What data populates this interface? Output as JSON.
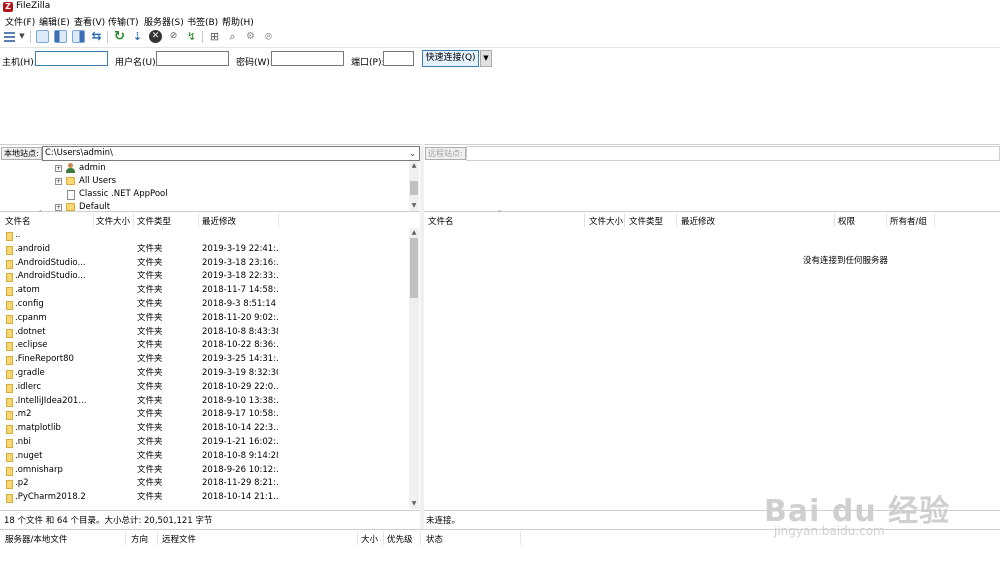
{
  "window": {
    "title": "FileZilla"
  },
  "menu": [
    "文件(F)",
    "编辑(E)",
    "查看(V)",
    "传输(T)",
    "服务器(S)",
    "书签(B)",
    "帮助(H)"
  ],
  "quickconnect": {
    "host_label": "主机(H):",
    "user_label": "用户名(U):",
    "pass_label": "密码(W):",
    "port_label": "端口(P):",
    "connect_label": "快速连接(Q)",
    "host_value": "",
    "user_value": "",
    "pass_value": "",
    "port_value": ""
  },
  "local": {
    "site_label": "本地站点:",
    "path": "C:\\Users\\admin\\",
    "tree": [
      {
        "label": "admin",
        "icon": "user-folder"
      },
      {
        "label": "All Users",
        "icon": "folder"
      },
      {
        "label": "Classic .NET AppPool",
        "icon": "document"
      },
      {
        "label": "Default",
        "icon": "folder"
      }
    ],
    "columns": [
      "文件名",
      "文件大小",
      "文件类型",
      "最近修改"
    ],
    "files": [
      {
        "name": "..",
        "type": "",
        "modified": ""
      },
      {
        "name": ".android",
        "type": "文件夹",
        "modified": "2019-3-19 22:41:..."
      },
      {
        "name": ".AndroidStudio...",
        "type": "文件夹",
        "modified": "2019-3-18 23:16:..."
      },
      {
        "name": ".AndroidStudio...",
        "type": "文件夹",
        "modified": "2019-3-18 22:33:..."
      },
      {
        "name": ".atom",
        "type": "文件夹",
        "modified": "2018-11-7 14:58:..."
      },
      {
        "name": ".config",
        "type": "文件夹",
        "modified": "2018-9-3 8:51:14"
      },
      {
        "name": ".cpanm",
        "type": "文件夹",
        "modified": "2018-11-20 9:02:..."
      },
      {
        "name": ".dotnet",
        "type": "文件夹",
        "modified": "2018-10-8 8:43:38"
      },
      {
        "name": ".eclipse",
        "type": "文件夹",
        "modified": "2018-10-22 8:36:..."
      },
      {
        "name": ".FineReport80",
        "type": "文件夹",
        "modified": "2019-3-25 14:31:..."
      },
      {
        "name": ".gradle",
        "type": "文件夹",
        "modified": "2019-3-19 8:32:30"
      },
      {
        "name": ".idlerc",
        "type": "文件夹",
        "modified": "2018-10-29 22:0..."
      },
      {
        "name": ".IntelliJIdea201...",
        "type": "文件夹",
        "modified": "2018-9-10 13:38:..."
      },
      {
        "name": ".m2",
        "type": "文件夹",
        "modified": "2018-9-17 10:58:..."
      },
      {
        "name": ".matplotlib",
        "type": "文件夹",
        "modified": "2018-10-14 22:3..."
      },
      {
        "name": ".nbi",
        "type": "文件夹",
        "modified": "2019-1-21 16:02:..."
      },
      {
        "name": ".nuget",
        "type": "文件夹",
        "modified": "2018-10-8 9:14:28"
      },
      {
        "name": ".omnisharp",
        "type": "文件夹",
        "modified": "2018-9-26 10:12:..."
      },
      {
        "name": ".p2",
        "type": "文件夹",
        "modified": "2018-11-29 8:21:..."
      },
      {
        "name": ".PyCharm2018.2",
        "type": "文件夹",
        "modified": "2018-10-14 21:1..."
      }
    ],
    "status": "18 个文件 和 64 个目录。大小总计: 20,501,121 字节"
  },
  "remote": {
    "site_label": "远程站点:",
    "columns": [
      "文件名",
      "文件大小",
      "文件类型",
      "最近修改",
      "权限",
      "所有者/组"
    ],
    "empty_message": "没有连接到任何服务器",
    "status": "未连接。"
  },
  "queue": {
    "columns": [
      "服务器/本地文件",
      "方向",
      "远程文件",
      "大小",
      "优先级",
      "状态"
    ]
  },
  "watermark": {
    "big": "Bai du 经验",
    "small": "jingyan.baidu.com"
  },
  "colors": {
    "folder": "#f8d775",
    "accent": "#3c7fb1"
  }
}
